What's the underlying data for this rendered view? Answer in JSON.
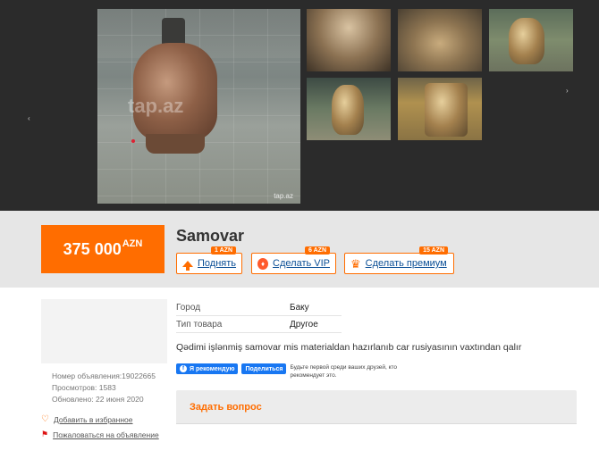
{
  "gallery": {
    "watermark": "tap.az",
    "watermark_corner": "tap.az"
  },
  "price": {
    "amount": "375 000",
    "currency": "AZN"
  },
  "title": "Samovar",
  "promo": [
    {
      "label": "Поднять",
      "price": "1 AZN",
      "icon": "arrow-up-icon"
    },
    {
      "label": "Сделать VIP",
      "price": "6 AZN",
      "icon": "vip-icon"
    },
    {
      "label": "Сделать премиум",
      "price": "15 AZN",
      "icon": "crown-icon"
    }
  ],
  "sidebar": {
    "meta": {
      "ad_number": "Номер объявления:19022665",
      "views": "Просмотров: 1583",
      "updated": "Обновлено: 22 июня 2020"
    },
    "favorite_label": "Добавить в избранное",
    "report_label": "Пожаловаться на объявление"
  },
  "properties": [
    {
      "key": "Город",
      "value": "Баку"
    },
    {
      "key": "Тип товара",
      "value": "Другое"
    }
  ],
  "description": "Qədimi işlənmiş samovar mis materialdan hazırlanıb car rusiyasının vaxtından qalır",
  "facebook": {
    "recommend_label": "Я рекомендую",
    "share_label": "Поделиться",
    "note": "Будьте первой среди ваших друзей, кто рекомендует это."
  },
  "ask_question_label": "Задать вопрос",
  "colors": {
    "accent": "#ff6d00",
    "link": "#0b4f96",
    "facebook": "#1877f2"
  }
}
